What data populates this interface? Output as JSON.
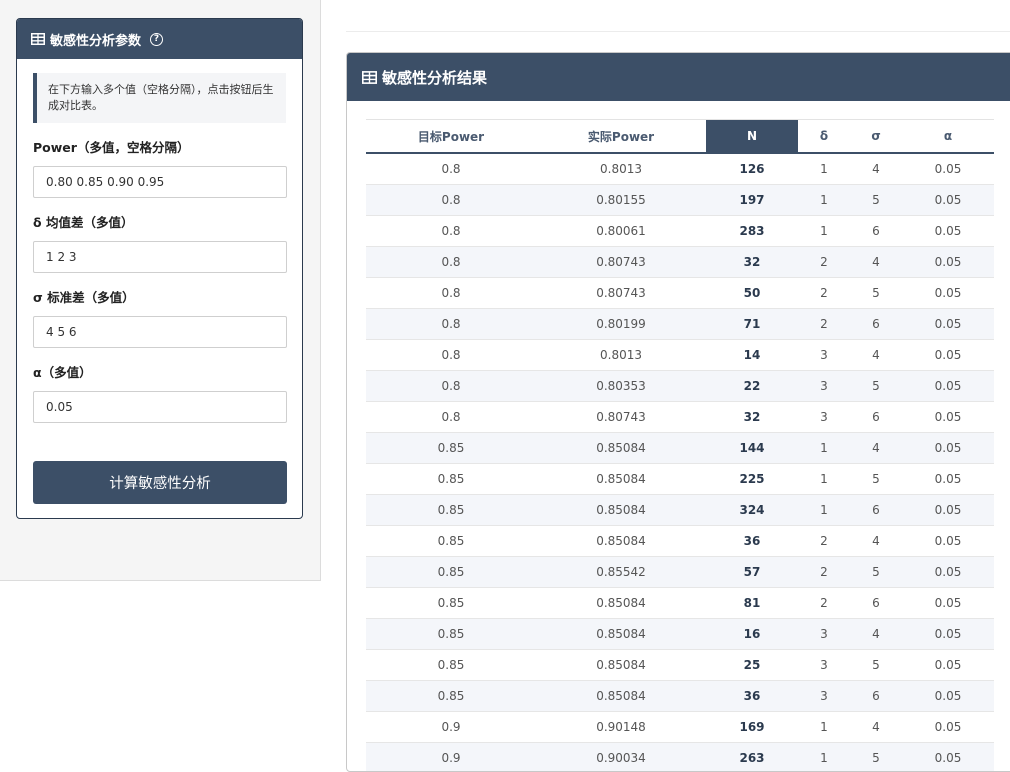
{
  "params": {
    "title": "敏感性分析参数",
    "help_icon": "?",
    "info_text": "在下方输入多个值（空格分隔），点击按钮后生成对比表。",
    "fields": [
      {
        "label": "Power（多值，空格分隔）",
        "value": "0.80 0.85 0.90 0.95"
      },
      {
        "label": "δ 均值差（多值）",
        "value": "1 2 3"
      },
      {
        "label": "σ 标准差（多值）",
        "value": "4 5 6"
      },
      {
        "label": "α（多值）",
        "value": "0.05"
      }
    ],
    "button_label": "计算敏感性分析"
  },
  "results": {
    "title": "敏感性分析结果",
    "columns": [
      "目标Power",
      "实际Power",
      "N",
      "δ",
      "σ",
      "α"
    ],
    "active_column": "N",
    "rows": [
      [
        "0.8",
        "0.8013",
        "126",
        "1",
        "4",
        "0.05"
      ],
      [
        "0.8",
        "0.80155",
        "197",
        "1",
        "5",
        "0.05"
      ],
      [
        "0.8",
        "0.80061",
        "283",
        "1",
        "6",
        "0.05"
      ],
      [
        "0.8",
        "0.80743",
        "32",
        "2",
        "4",
        "0.05"
      ],
      [
        "0.8",
        "0.80743",
        "50",
        "2",
        "5",
        "0.05"
      ],
      [
        "0.8",
        "0.80199",
        "71",
        "2",
        "6",
        "0.05"
      ],
      [
        "0.8",
        "0.8013",
        "14",
        "3",
        "4",
        "0.05"
      ],
      [
        "0.8",
        "0.80353",
        "22",
        "3",
        "5",
        "0.05"
      ],
      [
        "0.8",
        "0.80743",
        "32",
        "3",
        "6",
        "0.05"
      ],
      [
        "0.85",
        "0.85084",
        "144",
        "1",
        "4",
        "0.05"
      ],
      [
        "0.85",
        "0.85084",
        "225",
        "1",
        "5",
        "0.05"
      ],
      [
        "0.85",
        "0.85084",
        "324",
        "1",
        "6",
        "0.05"
      ],
      [
        "0.85",
        "0.85084",
        "36",
        "2",
        "4",
        "0.05"
      ],
      [
        "0.85",
        "0.85542",
        "57",
        "2",
        "5",
        "0.05"
      ],
      [
        "0.85",
        "0.85084",
        "81",
        "2",
        "6",
        "0.05"
      ],
      [
        "0.85",
        "0.85084",
        "16",
        "3",
        "4",
        "0.05"
      ],
      [
        "0.85",
        "0.85084",
        "25",
        "3",
        "5",
        "0.05"
      ],
      [
        "0.85",
        "0.85084",
        "36",
        "3",
        "6",
        "0.05"
      ],
      [
        "0.9",
        "0.90148",
        "169",
        "1",
        "4",
        "0.05"
      ],
      [
        "0.9",
        "0.90034",
        "263",
        "1",
        "5",
        "0.05"
      ]
    ]
  }
}
